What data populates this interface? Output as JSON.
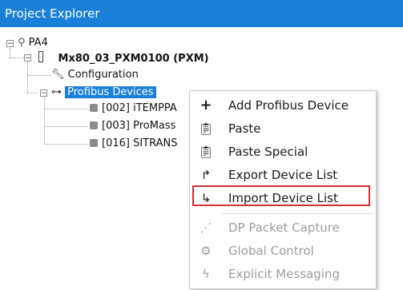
{
  "panel": {
    "title": "Project Explorer"
  },
  "tree": {
    "root": {
      "label": "PA4"
    },
    "device": {
      "label": "Mx80_03_PXM0100 (PXM)"
    },
    "configuration": {
      "label": "Configuration"
    },
    "profibus": {
      "label": "Profibus Devices"
    },
    "children": [
      {
        "label": "[002] iTEMPPA"
      },
      {
        "label": "[003] ProMass"
      },
      {
        "label": "[016] SITRANS"
      }
    ]
  },
  "context_menu": {
    "items": [
      {
        "label": "Add Profibus Device",
        "icon": "plus-icon",
        "enabled": true
      },
      {
        "label": "Paste",
        "icon": "paste-icon",
        "enabled": true
      },
      {
        "label": "Paste Special",
        "icon": "paste-special-icon",
        "enabled": true
      },
      {
        "label": "Export Device List",
        "icon": "export-icon",
        "enabled": true
      },
      {
        "label": "Import Device List",
        "icon": "import-icon",
        "enabled": true,
        "highlighted": true
      },
      {
        "label": "DP Packet Capture",
        "icon": "capture-icon",
        "enabled": false
      },
      {
        "label": "Global Control",
        "icon": "global-control-icon",
        "enabled": false
      },
      {
        "label": "Explicit Messaging",
        "icon": "messaging-icon",
        "enabled": false
      }
    ]
  },
  "colors": {
    "titlebar": "#1a7fd9",
    "selection": "#1a7fd9",
    "highlight": "#d32f2f"
  }
}
